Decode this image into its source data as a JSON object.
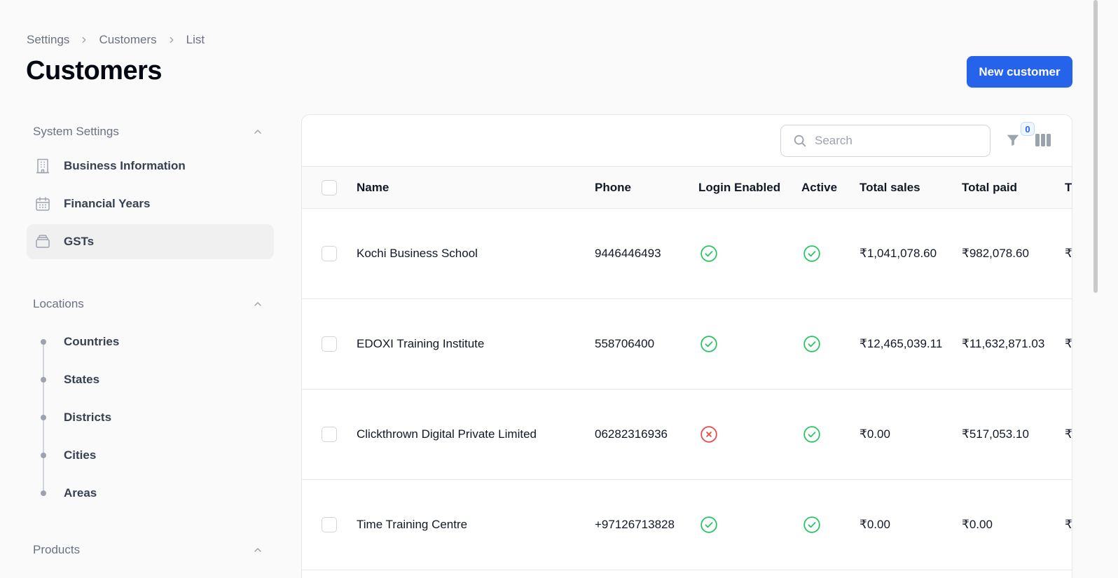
{
  "breadcrumb": [
    "Settings",
    "Customers",
    "List"
  ],
  "page_title": "Customers",
  "new_button_label": "New customer",
  "sidebar": {
    "groups": [
      {
        "title": "System Settings",
        "items": [
          {
            "label": "Business Information",
            "icon": "building-icon"
          },
          {
            "label": "Financial Years",
            "icon": "calendar-icon"
          },
          {
            "label": "GSTs",
            "icon": "stack-icon",
            "active": true
          }
        ]
      },
      {
        "title": "Locations",
        "items": [
          {
            "label": "Countries"
          },
          {
            "label": "States"
          },
          {
            "label": "Districts"
          },
          {
            "label": "Cities"
          },
          {
            "label": "Areas"
          }
        ]
      },
      {
        "title": "Products"
      }
    ]
  },
  "table": {
    "search_placeholder": "Search",
    "filter_count": "0",
    "columns": [
      "Name",
      "Phone",
      "Login Enabled",
      "Active",
      "Total sales",
      "Total paid",
      "T"
    ],
    "rows": [
      {
        "name": "Kochi Business School",
        "phone": "9446446493",
        "login_enabled": true,
        "active": true,
        "total_sales": "₹1,041,078.60",
        "total_paid": "₹982,078.60",
        "partial": "₹"
      },
      {
        "name": "EDOXI Training Institute",
        "phone": "558706400",
        "login_enabled": true,
        "active": true,
        "total_sales": "₹12,465,039.11",
        "total_paid": "₹11,632,871.03",
        "partial": "₹"
      },
      {
        "name": "Clickthrown Digital Private Limited",
        "phone": "06282316936",
        "login_enabled": false,
        "active": true,
        "total_sales": "₹0.00",
        "total_paid": "₹517,053.10",
        "partial": "₹"
      },
      {
        "name": "Time Training Centre",
        "phone": "+97126713828",
        "login_enabled": true,
        "active": true,
        "total_sales": "₹0.00",
        "total_paid": "₹0.00",
        "partial": "₹"
      }
    ]
  },
  "colors": {
    "accent": "#2563eb",
    "success": "#22c55e",
    "danger": "#ef4444"
  }
}
